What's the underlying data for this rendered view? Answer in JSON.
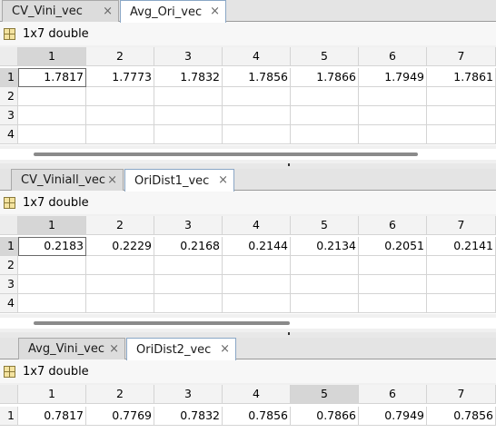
{
  "panes": [
    {
      "tabs": [
        {
          "label": "CV_Vini_vec",
          "close": "×",
          "active": false
        },
        {
          "label": "Avg_Ori_vec",
          "close": "×",
          "active": true
        }
      ],
      "info": "1x7 double",
      "columns": [
        "1",
        "2",
        "3",
        "4",
        "5",
        "6",
        "7"
      ],
      "rows": [
        "1",
        "2",
        "3",
        "4"
      ],
      "values": [
        "1.7817",
        "1.7773",
        "1.7832",
        "1.7856",
        "1.7866",
        "1.7949",
        "1.7861"
      ],
      "scroll_fraction": 0.75
    },
    {
      "tabs": [
        {
          "label": "CV_Viniall_vec",
          "close": "×",
          "active": false
        },
        {
          "label": "OriDist1_vec",
          "close": "×",
          "active": true
        }
      ],
      "info": "1x7 double",
      "columns": [
        "1",
        "2",
        "3",
        "4",
        "5",
        "6",
        "7"
      ],
      "rows": [
        "1",
        "2",
        "3",
        "4"
      ],
      "values": [
        "0.2183",
        "0.2229",
        "0.2168",
        "0.2144",
        "0.2134",
        "0.2051",
        "0.2141"
      ],
      "scroll_fraction": 0.5
    },
    {
      "tabs": [
        {
          "label": "Avg_Vini_vec",
          "close": "×",
          "active": false
        },
        {
          "label": "OriDist2_vec",
          "close": "×",
          "active": true
        }
      ],
      "info": "1x7 double",
      "columns": [
        "1",
        "2",
        "3",
        "4",
        "5",
        "6",
        "7"
      ],
      "rows": [
        "1"
      ],
      "values": [
        "0.7817",
        "0.7769",
        "0.7832",
        "0.7856",
        "0.7866",
        "0.7949",
        "0.7856"
      ]
    }
  ],
  "colors": {
    "accent_tab_border": "#8aa7c6",
    "selected_header": "#d6d6d6"
  }
}
